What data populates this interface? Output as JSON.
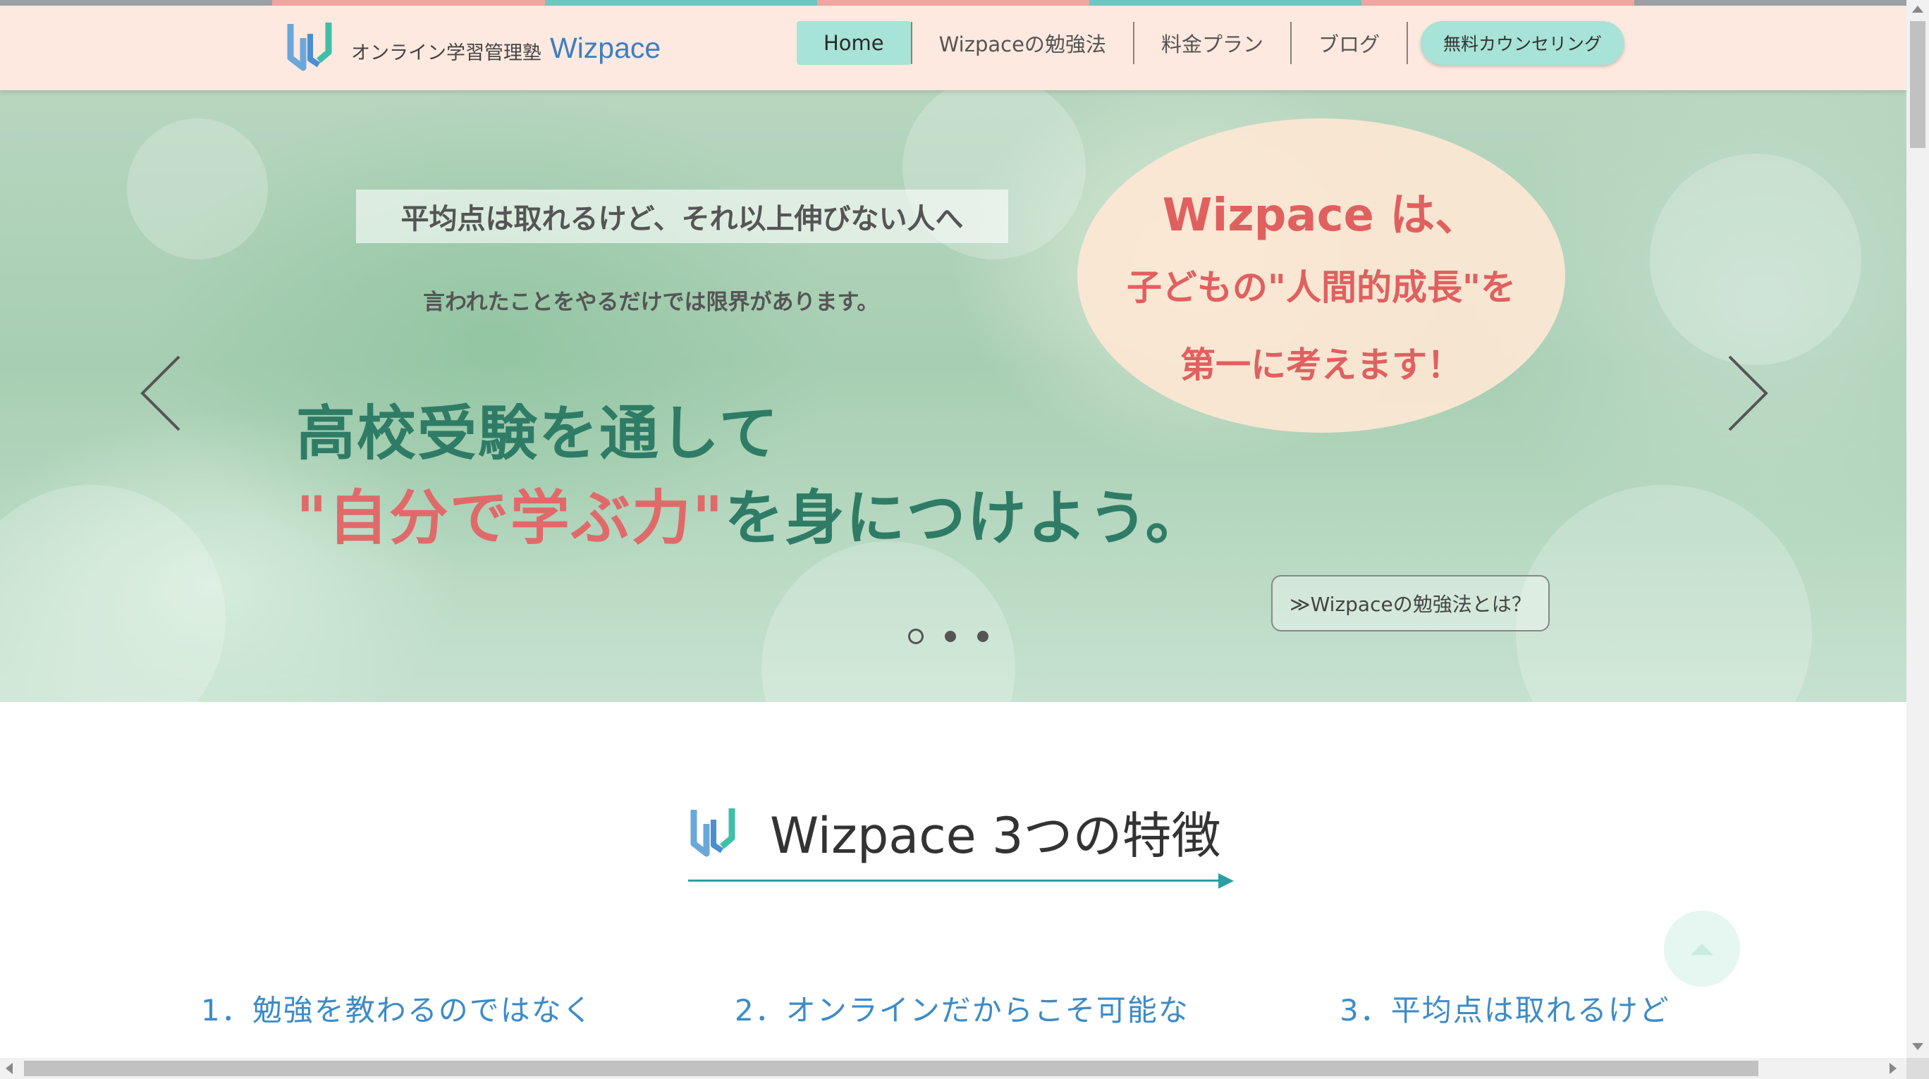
{
  "colors": {
    "strip": [
      "#9aa0a6",
      "#f0a5a0",
      "#6cc7c0",
      "#f0a5a0",
      "#6cc7c0",
      "#f0a5a0",
      "#9aa0a6"
    ],
    "header_bg": "#fde9df",
    "nav_active_bg": "#a7e3d6",
    "accent_green": "#2f7c66",
    "accent_red": "#e06a6a",
    "feature_blue": "#3d8bc8"
  },
  "header": {
    "logo_icon": "wizpace-logo-icon",
    "logo_subtitle": "オンライン学習管理塾",
    "logo_name": "Wizpace",
    "nav": [
      {
        "label": "Home",
        "active": true
      },
      {
        "label": "Wizpaceの勉強法",
        "active": false
      },
      {
        "label": "料金プラン",
        "active": false
      },
      {
        "label": "ブログ",
        "active": false
      }
    ],
    "cta_label": "無料カウンセリング"
  },
  "hero": {
    "tagline": "平均点は取れるけど、それ以上伸びない人へ",
    "subline": "言われたことをやるだけでは限界があります。",
    "headline_line1": "高校受験を通して",
    "headline_line2_red": "\"自分で学ぶ力\"",
    "headline_line2_rest": "を身につけよう。",
    "oval_line1": "Wizpace は、",
    "oval_line2": "子どもの\"人間的成長\"を",
    "oval_line3": "第一に考えます！",
    "button_label": "≫Wizpaceの勉強法とは？",
    "prev_icon": "chevron-left-icon",
    "next_icon": "chevron-right-icon",
    "slides_total": 3,
    "active_slide": 1
  },
  "features": {
    "title": "Wizpace 3つの特徴",
    "items": [
      {
        "label": "1．勉強を教わるのではなく"
      },
      {
        "label": "2．オンラインだからこそ可能な"
      },
      {
        "label": "3．平均点は取れるけど"
      }
    ],
    "scroll_top_icon": "chevron-up-icon"
  }
}
